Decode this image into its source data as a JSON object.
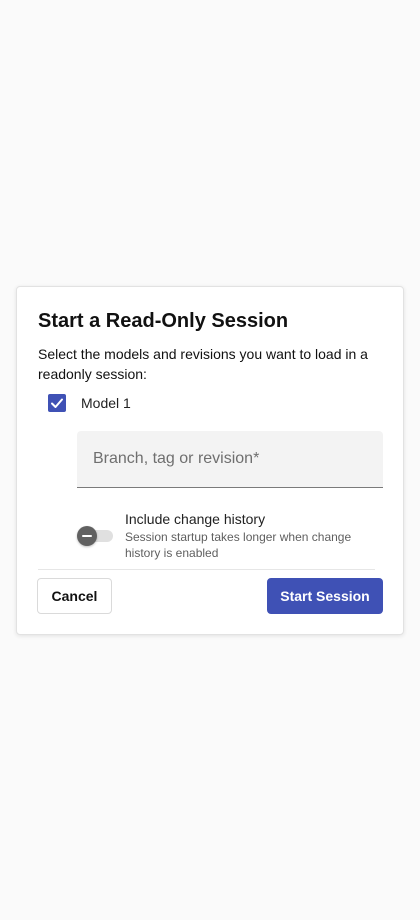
{
  "dialog": {
    "title": "Start a Read-Only Session",
    "description": "Select the models and revisions you want to load in a readonly session:",
    "model": {
      "label": "Model 1",
      "checked": true
    },
    "revision_field": {
      "placeholder": "Branch, tag or revision*",
      "value": ""
    },
    "change_history": {
      "title": "Include change history",
      "hint": "Session startup takes longer when change history is enabled",
      "enabled": false
    },
    "buttons": {
      "cancel_label": "Cancel",
      "start_label": "Start Session"
    }
  },
  "icons": {
    "checkbox": "check-icon"
  },
  "colors": {
    "accent": "#3f51b5",
    "background": "#fafafa",
    "toggle_thumb": "#616161",
    "toggle_track": "#e0e0e0"
  }
}
